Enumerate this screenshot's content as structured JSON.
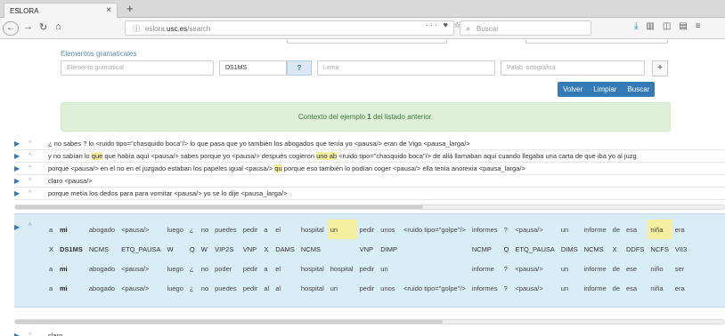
{
  "browser": {
    "tab_title": "ESLORA",
    "tab_close": "×",
    "new_tab": "+",
    "url_prefix": "eslora.",
    "url_domain": "usc.es",
    "url_path": "/search",
    "search_placeholder": "Buscar",
    "page_actions": "··· ♥ ☆"
  },
  "form": {
    "section_title": "Elementos gramaticales",
    "grammatical_placeholder": "Elemento gramatical",
    "tag_value": "DS1MS",
    "help_label": "?",
    "lemma_placeholder": "Lema",
    "orthographic_placeholder": "Palab. ortográfica",
    "add_label": "+",
    "buttons": [
      "Volver",
      "Limpiar",
      "Buscar"
    ]
  },
  "alert": {
    "prefix": "Contexto del ejemplo ",
    "number": "1",
    "suffix": " del listado anterior."
  },
  "context_rows": [
    {
      "segments": [
        {
          "t": "¿ no sabes ? lo <ruido tipo=\"chasquido boca\"/> lo que pasa que yo también los abogados que tenía yo <pausa/> eran de Vigo <pausa_larga/>",
          "h": false
        }
      ]
    },
    {
      "segments": [
        {
          "t": "y no sabían lo ",
          "h": false
        },
        {
          "t": "que",
          "h": true
        },
        {
          "t": " que había aquí <pausa/> sabes porque yo <pausa/> después cogieron ",
          "h": false
        },
        {
          "t": "uno ab",
          "h": true
        },
        {
          "t": " <ruido tipo=\"chasquido boca\"/> de allá llamaban aquí cuando llegaba una carta de que iba yo al juzg",
          "h": false
        }
      ]
    },
    {
      "segments": [
        {
          "t": "porque <pausa/> en el no en el juzgado estaban los papeles igual <pausa/> ",
          "h": false
        },
        {
          "t": "qu",
          "h": true
        },
        {
          "t": " porque eso también lo podían coger <pausa/> ella tenía anorexia <pausa_larga/>",
          "h": false
        }
      ]
    },
    {
      "segments": [
        {
          "t": "claro <pausa/>",
          "h": false
        }
      ]
    },
    {
      "segments": [
        {
          "t": "porque metía los dedos para para vomitar <pausa/> yo se lo dije <pausa_larga/>",
          "h": false
        }
      ]
    }
  ],
  "detail": {
    "rows": [
      [
        "a",
        "mi",
        "abogado",
        "<pausa/>",
        "luego",
        "¿",
        "no",
        "puedes",
        "pedir",
        "a",
        "el",
        "hospital",
        "un",
        "pedir",
        "unos",
        "<ruido tipo=\"golpe\"/>",
        "informes",
        "?",
        "<pausa/>",
        "un",
        "informe",
        "de",
        "esa",
        "niña",
        "era"
      ],
      [
        "X",
        "DS1MS",
        "NCMS",
        "ETQ_PAUSA",
        "W",
        "Q",
        "W",
        "VIP2S",
        "VNP",
        "X",
        "DAMS",
        "NCMS",
        "",
        "VNP",
        "DIMP",
        "",
        "NCMP",
        "Q",
        "ETQ_PAUSA",
        "DIMS",
        "NCMS",
        "X",
        "DDFS",
        "NCFS",
        "VII3"
      ],
      [
        "a",
        "mi",
        "abogado",
        "<pausa/>",
        "luego",
        "¿",
        "no",
        "poder",
        "pedir",
        "a",
        "el",
        "hospital",
        "hospital",
        "pedir",
        "un",
        "",
        "informe",
        "?",
        "<pausa/>",
        "un",
        "informe",
        "de",
        "ese",
        "niño",
        "ser"
      ],
      [
        "a",
        "mi",
        "abogado",
        "<pausa/>",
        "luego",
        "¿",
        "no",
        "puedes",
        "pedir",
        "al",
        "al",
        "hospital",
        "un",
        "pedir",
        "unos",
        "<ruido tipo=\"golpe\"/>",
        "informes",
        "?",
        "<pausa/>",
        "un",
        "informe",
        "de",
        "esa",
        "niña",
        "era"
      ]
    ]
  },
  "last_row": "claro",
  "colors": {
    "primary": "#337ab7",
    "alert_bg": "#dff0d8",
    "detail_bg": "#d9edf7",
    "highlight": "#f5f0a0"
  }
}
